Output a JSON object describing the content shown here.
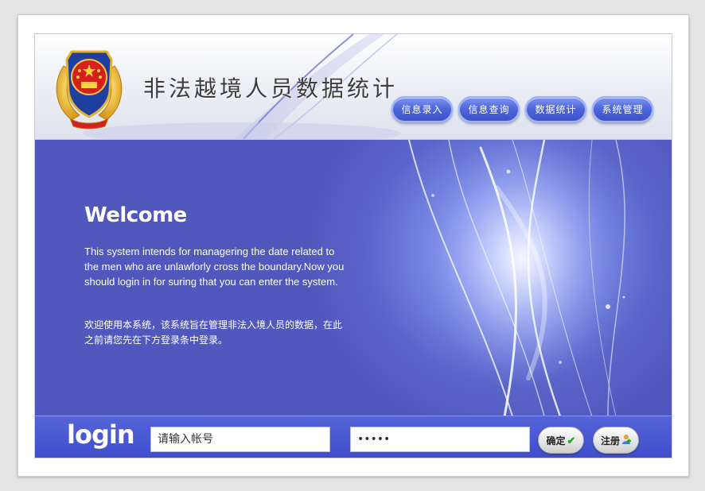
{
  "header": {
    "title": "非法越境人员数据统计",
    "emblem_icon": "national-emblem-icon",
    "nav": [
      {
        "label": "信息录入"
      },
      {
        "label": "信息查询"
      },
      {
        "label": "数据统计"
      },
      {
        "label": "系统管理"
      }
    ]
  },
  "welcome": {
    "title": "Welcome",
    "text_en": "This system intends for managering the date related to the men who are unlawforly cross the boundary.Now you should login in for suring that you can enter the system.",
    "text_cn": "欢迎使用本系统，该系统旨在管理非法入境人员的数据，在此之前请您先在下方登录条中登录。"
  },
  "login": {
    "label": "login",
    "account_placeholder": "请输入帐号",
    "password_value": "•••••",
    "confirm_label": "确定",
    "confirm_icon": "check-icon",
    "register_label": "注册",
    "register_icon": "user-add-icon"
  },
  "colors": {
    "banner": "#5a65c9",
    "nav_button": "#4f68db",
    "login_bar": "#4754d2"
  }
}
